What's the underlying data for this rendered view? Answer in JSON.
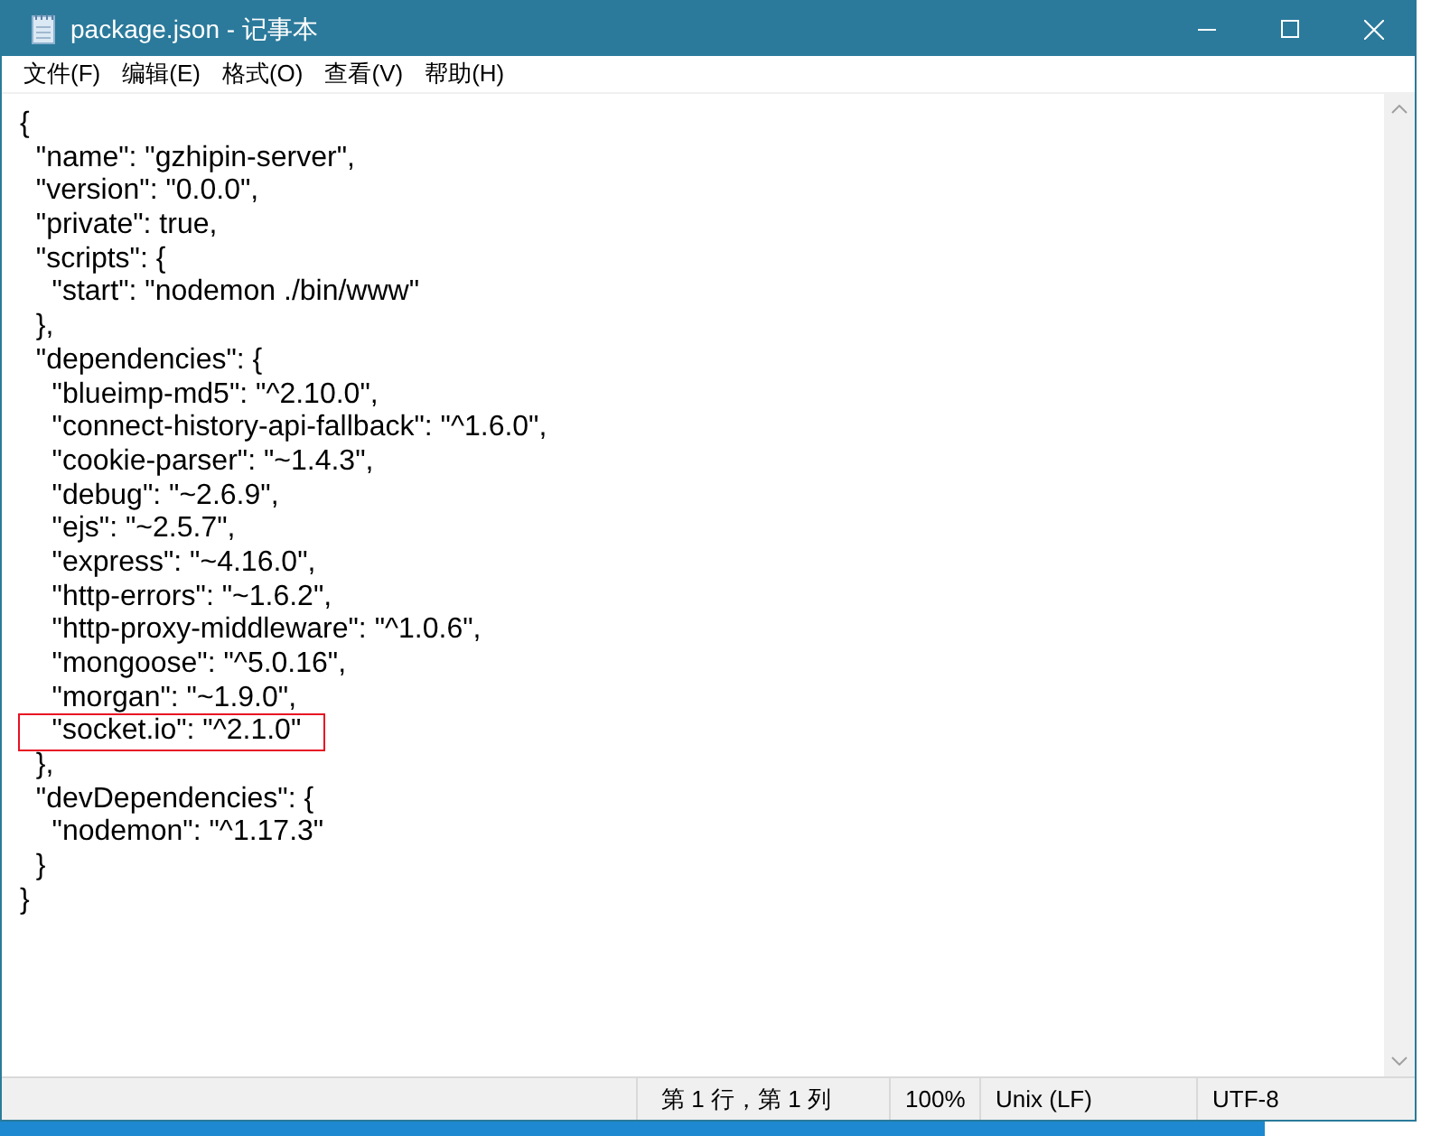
{
  "window": {
    "title": "package.json - 记事本"
  },
  "menu": [
    "文件(F)",
    "编辑(E)",
    "格式(O)",
    "查看(V)",
    "帮助(H)"
  ],
  "editor": {
    "lines": [
      {
        "text": "{",
        "highlighted": false
      },
      {
        "text": "  \"name\": \"gzhipin-server\",",
        "highlighted": false
      },
      {
        "text": "  \"version\": \"0.0.0\",",
        "highlighted": false
      },
      {
        "text": "  \"private\": true,",
        "highlighted": false
      },
      {
        "text": "  \"scripts\": {",
        "highlighted": false
      },
      {
        "text": "    \"start\": \"nodemon ./bin/www\"",
        "highlighted": false
      },
      {
        "text": "  },",
        "highlighted": false
      },
      {
        "text": "  \"dependencies\": {",
        "highlighted": false
      },
      {
        "text": "    \"blueimp-md5\": \"^2.10.0\",",
        "highlighted": false
      },
      {
        "text": "    \"connect-history-api-fallback\": \"^1.6.0\",",
        "highlighted": false
      },
      {
        "text": "    \"cookie-parser\": \"~1.4.3\",",
        "highlighted": false
      },
      {
        "text": "    \"debug\": \"~2.6.9\",",
        "highlighted": false
      },
      {
        "text": "    \"ejs\": \"~2.5.7\",",
        "highlighted": false
      },
      {
        "text": "    \"express\": \"~4.16.0\",",
        "highlighted": false
      },
      {
        "text": "    \"http-errors\": \"~1.6.2\",",
        "highlighted": false
      },
      {
        "text": "    \"http-proxy-middleware\": \"^1.0.6\",",
        "highlighted": false
      },
      {
        "text": "    \"mongoose\": \"^5.0.16\",",
        "highlighted": false
      },
      {
        "text": "    \"morgan\": \"~1.9.0\",",
        "highlighted": false
      },
      {
        "text": "    \"socket.io\": \"^2.1.0\"",
        "highlighted": true
      },
      {
        "text": "  },",
        "highlighted": false
      },
      {
        "text": "  \"devDependencies\": {",
        "highlighted": false
      },
      {
        "text": "    \"nodemon\": \"^1.17.3\"",
        "highlighted": false
      },
      {
        "text": "  }",
        "highlighted": false
      },
      {
        "text": "}",
        "highlighted": false
      }
    ]
  },
  "status_bar": {
    "position": "第 1 行，第 1 列",
    "zoom": "100%",
    "line_ending": "Unix (LF)",
    "encoding": "UTF-8"
  }
}
